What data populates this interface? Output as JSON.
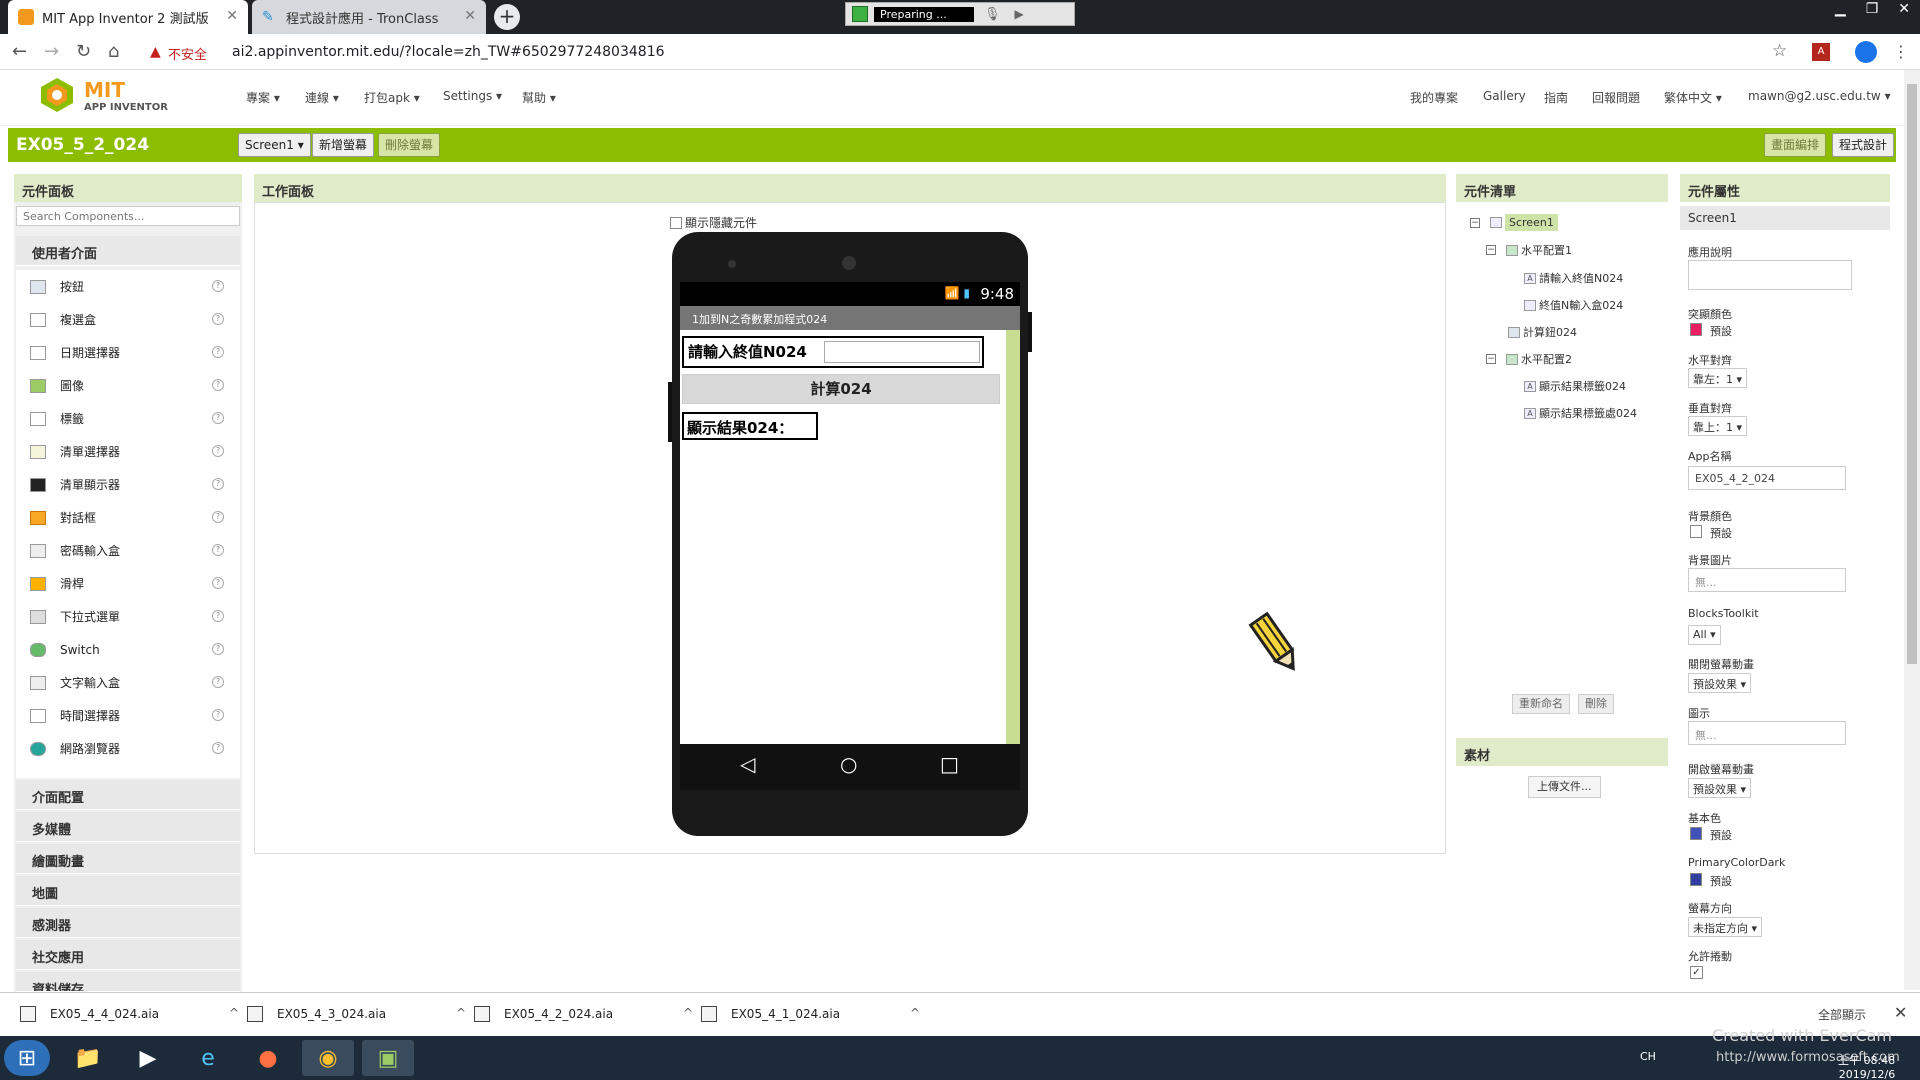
{
  "browser": {
    "tabs": [
      {
        "title": "MIT App Inventor 2 測試版"
      },
      {
        "title": "程式設計應用 - TronClass"
      }
    ],
    "recorder_status": "Preparing ...",
    "insecure_label": "不安全",
    "url": "ai2.appinventor.mit.edu/?locale=zh_TW#6502977248034816"
  },
  "header": {
    "logo_mit": "MIT",
    "logo_sub": "APP INVENTOR",
    "menus": [
      "專案",
      "連線",
      "打包apk",
      "Settings",
      "幫助"
    ],
    "right_menus": [
      "我的專案",
      "Gallery",
      "指南",
      "回報問題",
      "繁体中文",
      "mawn@g2.usc.edu.tw"
    ]
  },
  "project": {
    "name": "EX05_5_2_024",
    "screen_select": "Screen1",
    "add_screen": "新增螢幕",
    "remove_screen": "刪除螢幕",
    "designer": "畫面編排",
    "blocks": "程式設計"
  },
  "palette": {
    "title": "元件面板",
    "search_placeholder": "Search Components...",
    "user_interface": "使用者介面",
    "components": [
      "按鈕",
      "複選盒",
      "日期選擇器",
      "圖像",
      "標籤",
      "清單選擇器",
      "清單顯示器",
      "對話框",
      "密碼輸入盒",
      "滑桿",
      "下拉式選單",
      "Switch",
      "文字輸入盒",
      "時間選擇器",
      "網路瀏覽器"
    ],
    "categories": [
      "介面配置",
      "多媒體",
      "繪圖動畫",
      "地圖",
      "感測器",
      "社交應用",
      "資料儲存"
    ]
  },
  "viewer": {
    "title": "工作面板",
    "show_hidden": "顯示隱藏元件",
    "status_time": "9:48",
    "app_title": "1加到N之奇數累加程式024",
    "label_prompt": "請輸入終值N024",
    "button_calc": "計算024",
    "label_result": "顯示結果024："
  },
  "tree": {
    "title": "元件清單",
    "nodes": {
      "screen1": "Screen1",
      "hbox1": "水平配置1",
      "label1": "請輸入終值N024",
      "textbox1": "終值N輸入盒024",
      "button1": "計算鈕024",
      "hbox2": "水平配置2",
      "label2": "顯示結果標籤024",
      "label3": "顯示結果標籤處024"
    },
    "rename": "重新命名",
    "delete": "刪除"
  },
  "media": {
    "title": "素材",
    "upload": "上傳文件..."
  },
  "properties": {
    "title": "元件屬性",
    "component": "Screen1",
    "about_label": "應用說明",
    "accent_label": "突顯顏色",
    "accent_value": "預設",
    "accent_color": "#e91e63",
    "align_h_label": "水平對齊",
    "align_h_value": "靠左：1",
    "align_v_label": "垂直對齊",
    "align_v_value": "靠上：1",
    "appname_label": "App名稱",
    "appname_value": "EX05_4_2_024",
    "bgcolor_label": "背景顏色",
    "bgcolor_value": "預設",
    "bgimage_label": "背景圖片",
    "bgimage_value": "無...",
    "toolkit_label": "BlocksToolkit",
    "toolkit_value": "All",
    "close_anim_label": "關閉螢幕動畫",
    "close_anim_value": "預設效果",
    "icon_label": "圖示",
    "icon_value": "無...",
    "open_anim_label": "開啟螢幕動畫",
    "open_anim_value": "預設效果",
    "primary_label": "基本色",
    "primary_value": "預設",
    "primary_color": "#3f51b5",
    "primary_dark_label": "PrimaryColorDark",
    "primary_dark_value": "預設",
    "primary_dark_color": "#303f9f",
    "orientation_label": "螢幕方向",
    "orientation_value": "未指定方向",
    "scroll_label": "允許捲動"
  },
  "downloads": {
    "files": [
      "EX05_4_4_024.aia",
      "EX05_4_3_024.aia",
      "EX05_4_2_024.aia",
      "EX05_4_1_024.aia"
    ],
    "show_all": "全部顯示"
  },
  "taskbar": {
    "lang": "CH",
    "watermark_1": "Created with EverCam",
    "watermark_2": "http://www.formosasoft.com",
    "time": "上午 08:48",
    "date": "2019/12/6"
  },
  "colors": {
    "accent_green": "#8cbd00",
    "panel_header": "#e0ebc9"
  }
}
